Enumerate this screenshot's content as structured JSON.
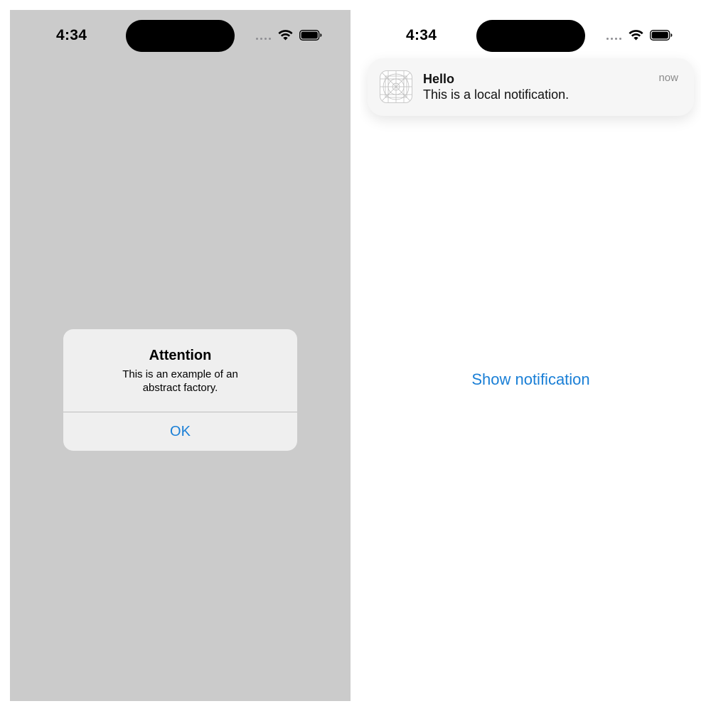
{
  "left_screen": {
    "status_bar": {
      "time": "4:34"
    },
    "alert": {
      "title": "Attention",
      "message": "This is an example of an abstract factory.",
      "ok_label": "OK"
    }
  },
  "right_screen": {
    "status_bar": {
      "time": "4:34"
    },
    "notification": {
      "title": "Hello",
      "body": "This is a local notification.",
      "time": "now",
      "icon": "app-icon-placeholder"
    },
    "show_button_label": "Show notification"
  },
  "colors": {
    "accent": "#1a7fd6",
    "dim_background": "#cbcbcb",
    "alert_background": "#efefef",
    "notification_background": "#f6f6f6"
  }
}
